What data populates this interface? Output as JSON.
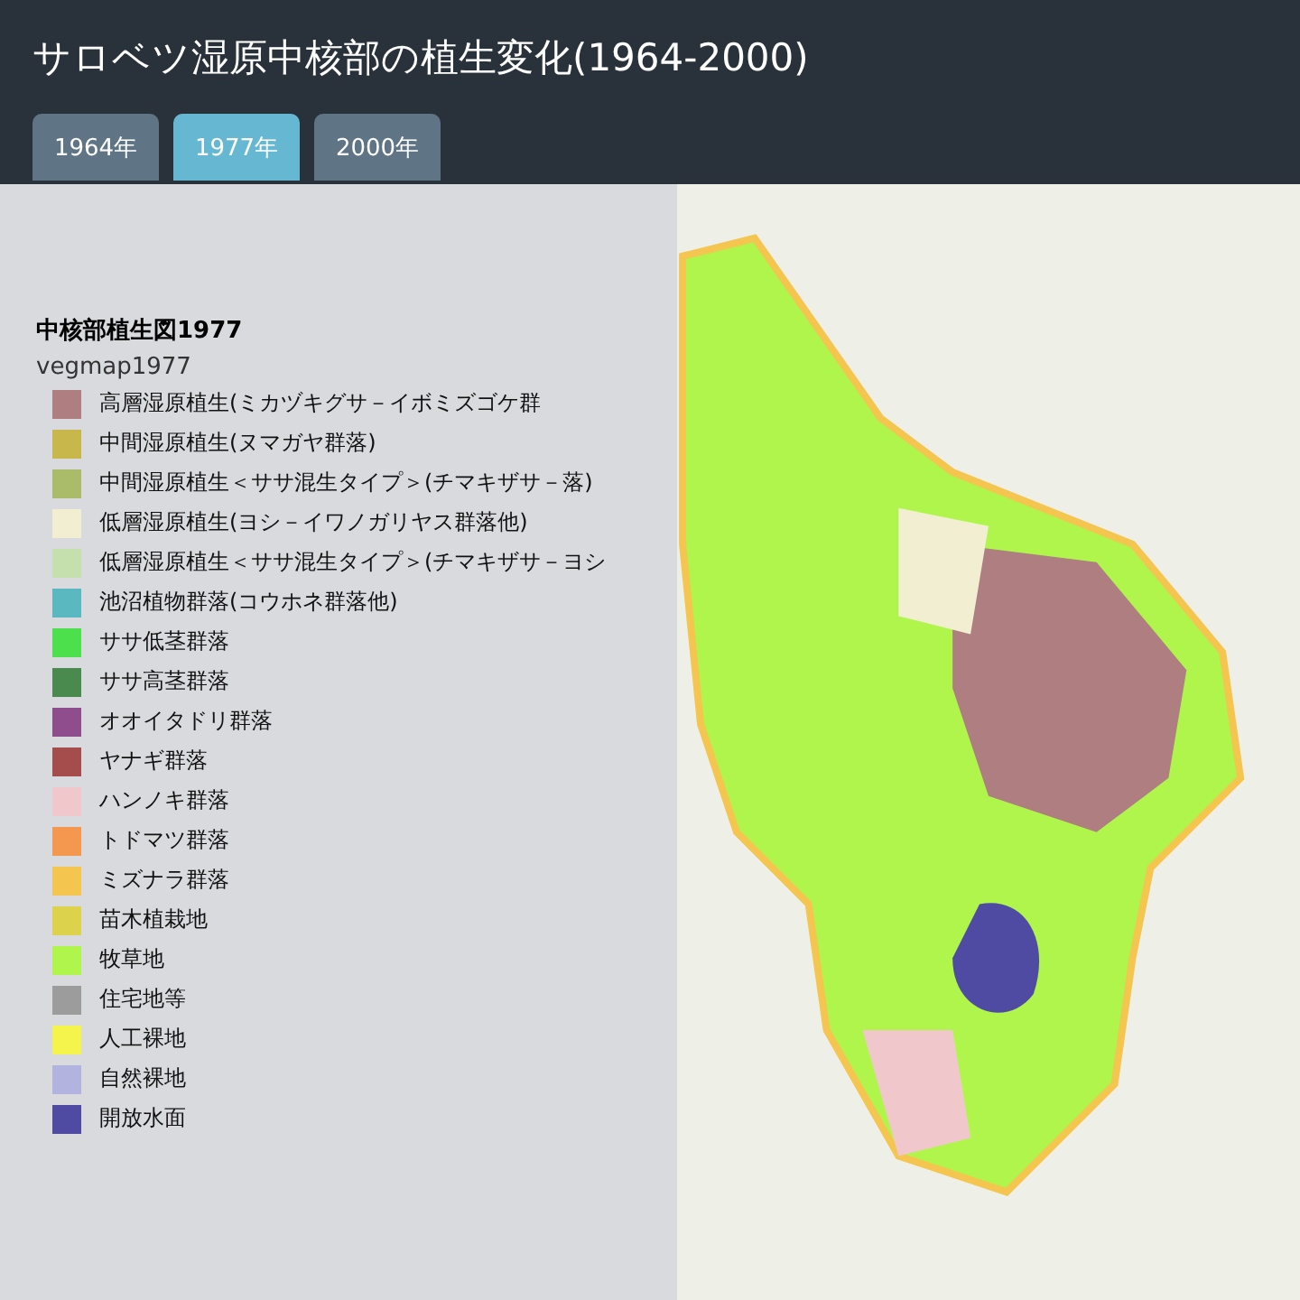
{
  "header": {
    "title": "サロベツ湿原中核部の植生変化(1964-2000)"
  },
  "tabs": [
    {
      "label": "1964年",
      "selected": false
    },
    {
      "label": "1977年",
      "selected": true
    },
    {
      "label": "2000年",
      "selected": false
    }
  ],
  "legend": {
    "title": "中核部植生図1977",
    "layer": "vegmap1977",
    "items": [
      {
        "label": "高層湿原植生(ミカヅキグサ－イボミズゴケ群",
        "color": "#ae7e80"
      },
      {
        "label": "中間湿原植生(ヌマガヤ群落)",
        "color": "#c8b84c"
      },
      {
        "label": "中間湿原植生＜ササ混生タイプ＞(チマキザサ－落)",
        "color": "#aabb6a"
      },
      {
        "label": "低層湿原植生(ヨシ－イワノガリヤス群落他)",
        "color": "#f1eed2"
      },
      {
        "label": "低層湿原植生＜ササ混生タイプ＞(チマキザサ－ヨシ",
        "color": "#c5dfad"
      },
      {
        "label": "池沼植物群落(コウホネ群落他)",
        "color": "#5ab8c0"
      },
      {
        "label": "ササ低茎群落",
        "color": "#4ce04c"
      },
      {
        "label": "ササ高茎群落",
        "color": "#4a8a4e"
      },
      {
        "label": "オオイタドリ群落",
        "color": "#8f4d8d"
      },
      {
        "label": "ヤナギ群落",
        "color": "#a54c4c"
      },
      {
        "label": "ハンノキ群落",
        "color": "#f0c8cb"
      },
      {
        "label": "トドマツ群落",
        "color": "#f4984f"
      },
      {
        "label": "ミズナラ群落",
        "color": "#f4c54f"
      },
      {
        "label": "苗木植栽地",
        "color": "#dcd24c"
      },
      {
        "label": "牧草地",
        "color": "#b0f54c"
      },
      {
        "label": "住宅地等",
        "color": "#9c9c9c"
      },
      {
        "label": "人工裸地",
        "color": "#f4f44c"
      },
      {
        "label": "自然裸地",
        "color": "#b3b3e0"
      },
      {
        "label": "開放水面",
        "color": "#4f4ba3"
      }
    ]
  }
}
